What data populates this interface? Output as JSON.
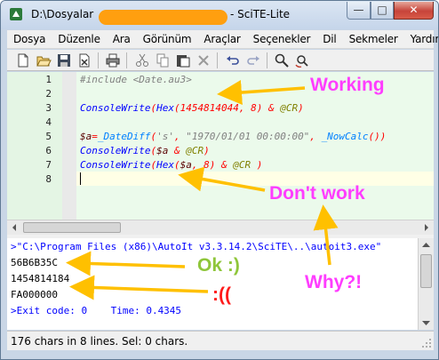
{
  "window": {
    "title_path": "D:\\Dosyalar",
    "title_app": " - SciTE-Lite",
    "minimize_glyph": "—",
    "maximize_glyph": "□",
    "close_glyph": "✕"
  },
  "menu": {
    "items": [
      "Dosya",
      "Düzenle",
      "Ara",
      "Görünüm",
      "Araçlar",
      "Seçenekler",
      "Dil",
      "Sekmeler",
      "Yardım"
    ]
  },
  "toolbar": {
    "icons": [
      "new-file-icon",
      "open-folder-icon",
      "save-icon",
      "close-file-icon",
      "print-icon",
      "cut-icon",
      "copy-icon",
      "paste-icon",
      "delete-icon",
      "undo-icon",
      "redo-icon",
      "find-icon",
      "replace-icon"
    ]
  },
  "editor": {
    "line_numbers": [
      "1",
      "2",
      "3",
      "4",
      "5",
      "6",
      "7",
      "8"
    ],
    "lines": {
      "l1": {
        "a": "#include ",
        "b": "<Date.au3>"
      },
      "l3": {
        "a": "ConsoleWrite",
        "b": "(",
        "c": "Hex",
        "d": "(",
        "e": "1454814044",
        "f": ", ",
        "g": "8",
        "h": ") & ",
        "i": "@CR",
        "j": ")"
      },
      "l5": {
        "a": "$a",
        "b": "=",
        "c": "_DateDiff",
        "d": "(",
        "e": "'s'",
        "f": ", ",
        "g": "\"1970/01/01 00:00:00\"",
        "h": ", ",
        "i": "_NowCalc",
        "j": "())"
      },
      "l6": {
        "a": "ConsoleWrite",
        "b": "(",
        "c": "$a",
        "d": " & ",
        "e": "@CR",
        "f": ")"
      },
      "l7": {
        "a": "ConsoleWrite",
        "b": "(",
        "c": "Hex",
        "d": "(",
        "e": "$a",
        "f": ", ",
        "g": "8",
        "h": ") & ",
        "i": "@CR",
        "j": " )"
      }
    }
  },
  "output": {
    "lines": [
      ">\"C:\\Program Files (x86)\\AutoIt v3.3.14.2\\SciTE\\..\\autoit3.exe\"",
      "56B6B35C",
      "1454814184",
      "FA000000",
      ">Exit code: 0    Time: 0.4345"
    ]
  },
  "status": {
    "text": "176 chars in 8 lines. Sel: 0 chars."
  },
  "annotations": {
    "working": "Working",
    "dont_work": "Don't work",
    "ok": "Ok :)",
    "why": "Why?!",
    "sad": ":(("
  },
  "colors": {
    "annotation_pink": "#ff3dff",
    "annotation_orange": "#ffc000",
    "annotation_green": "#8fc63b",
    "annotation_red": "#ff1a1a",
    "title_highlight": "#ff9f0f"
  }
}
